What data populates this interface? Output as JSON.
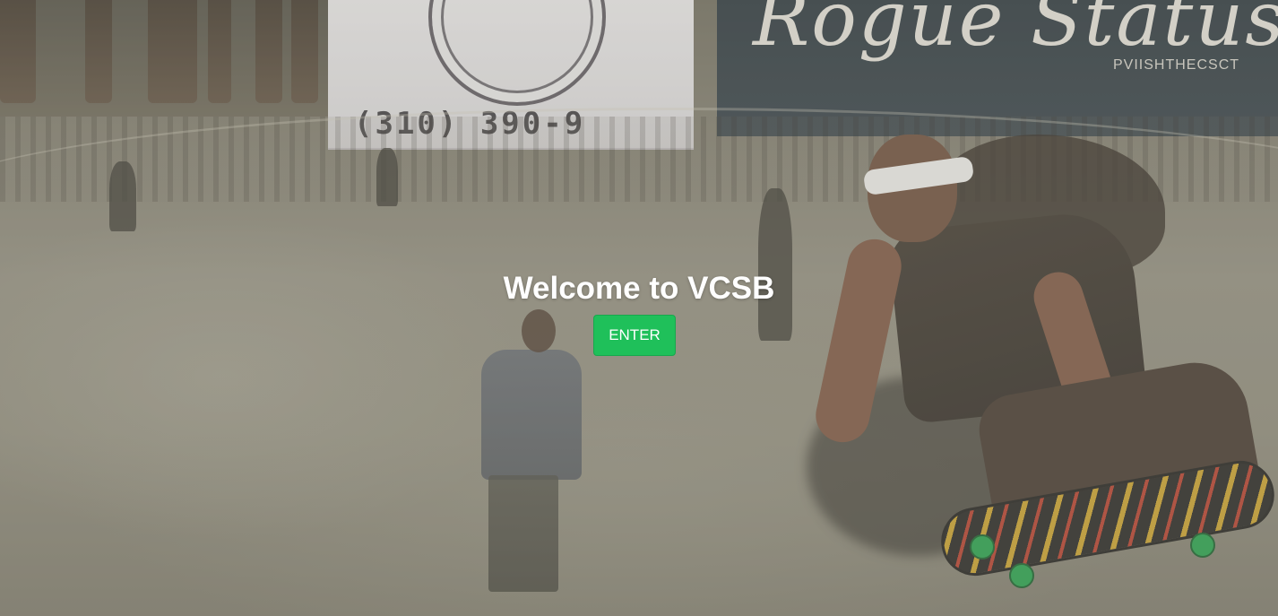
{
  "welcome": {
    "title": "Welcome to VCSB",
    "enter_label": "ENTER"
  },
  "background": {
    "banner_phone": "(310) 390-9",
    "sign_script": "Rogue Status",
    "sign_small": "PVIISHTHECSCT"
  },
  "colors": {
    "enter_button": "#1fc05a",
    "title_text": "#ffffff"
  }
}
